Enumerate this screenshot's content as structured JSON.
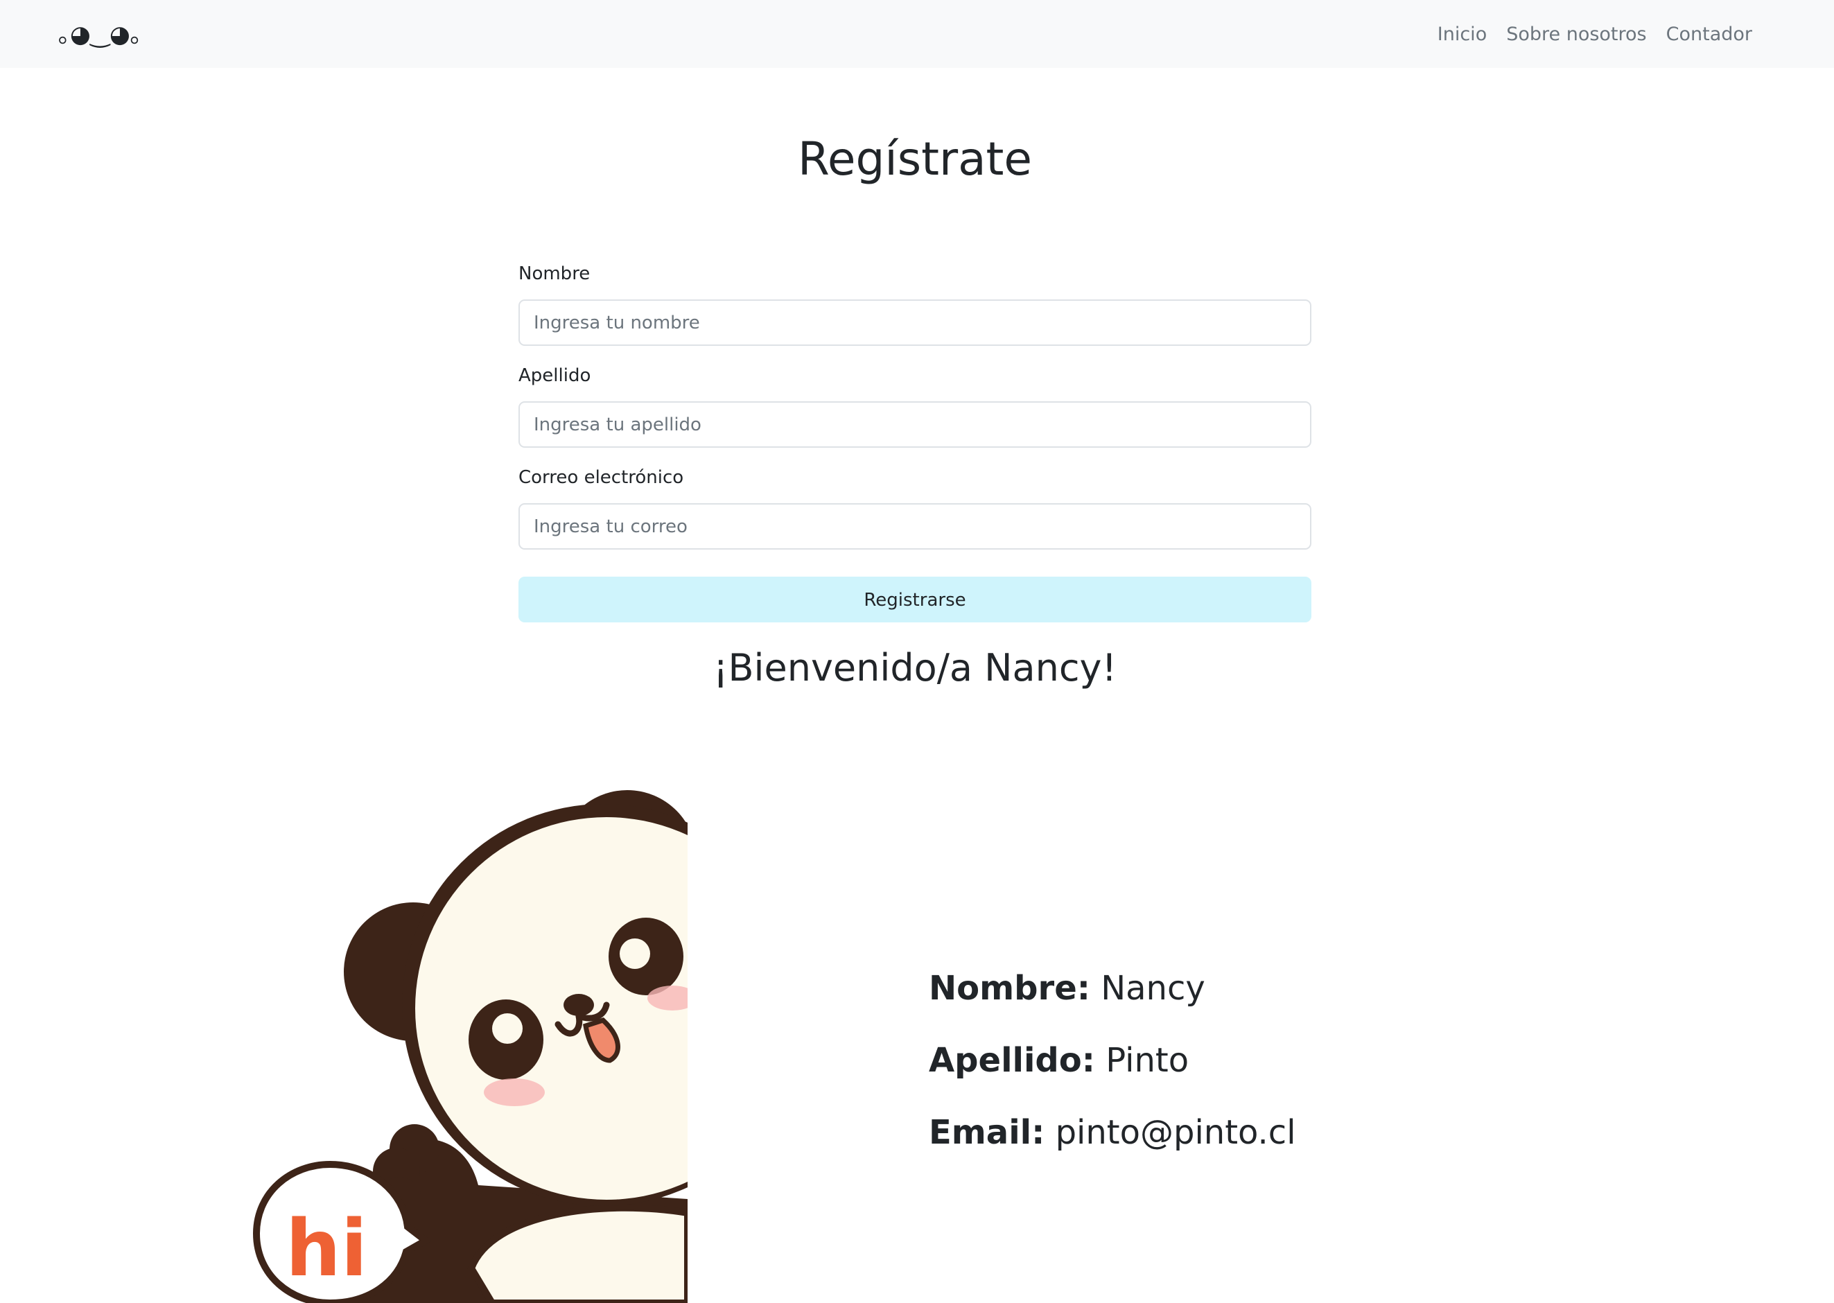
{
  "navbar": {
    "brand": "｡◕‿◕｡",
    "links": [
      "Inicio",
      "Sobre nosotros",
      "Contador"
    ]
  },
  "page": {
    "title": "Regístrate"
  },
  "form": {
    "fields": [
      {
        "label": "Nombre",
        "placeholder": "Ingresa tu nombre",
        "value": ""
      },
      {
        "label": "Apellido",
        "placeholder": "Ingresa tu apellido",
        "value": ""
      },
      {
        "label": "Correo electrónico",
        "placeholder": "Ingresa tu correo",
        "value": ""
      }
    ],
    "submit_label": "Registrarse"
  },
  "welcome": {
    "heading": "¡Bienvenido/a Nancy!"
  },
  "mascot": {
    "speech_text": "hi",
    "colors": {
      "outline": "#3d2418",
      "face": "#fdf9ec",
      "speech": "#ee6134"
    }
  },
  "summary": {
    "name_label": "Nombre:",
    "name_value": "Nancy",
    "surname_label": "Apellido:",
    "surname_value": "Pinto",
    "email_label": "Email:",
    "email_value": "pinto@pinto.cl"
  },
  "colors": {
    "navbar_bg": "#f8f9fa",
    "button_bg": "#cff4fc",
    "text": "#212529",
    "muted": "#6c757d"
  }
}
